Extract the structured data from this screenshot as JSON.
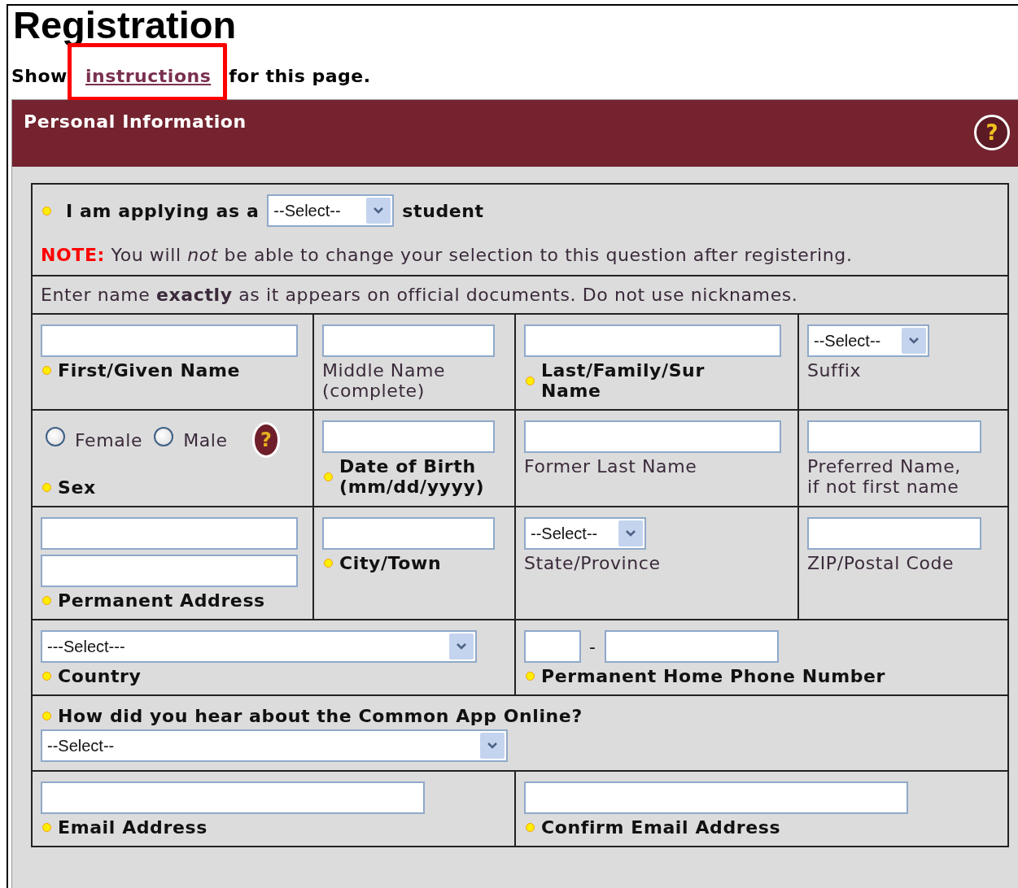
{
  "title": "Registration",
  "intro": {
    "before": "Show",
    "link": "instructions",
    "after": "for this page.",
    "highlighted": true
  },
  "panel": {
    "title": "Personal Information",
    "help": "?"
  },
  "applying": {
    "label": "I am applying as a",
    "required": true,
    "select": "--Select--",
    "after": "student",
    "note_label": "NOTE:",
    "note": "You will *not* be able to change your selection to this question after registering."
  },
  "name_hint": "Enter name **exactly** as it appears on official documents. Do not use nicknames.",
  "rows": [
    [
      {
        "kind": "field",
        "controls": [
          {
            "kind": "text"
          }
        ],
        "label": "First/Given Name",
        "required": true
      },
      {
        "kind": "field",
        "controls": [
          {
            "kind": "text"
          }
        ],
        "label": "Middle Name (complete)",
        "required": false
      },
      {
        "kind": "field",
        "controls": [
          {
            "kind": "text"
          }
        ],
        "label": "Last/Family/Sur Name",
        "required": true
      },
      {
        "kind": "field",
        "controls": [
          {
            "kind": "select",
            "value": "--Select--"
          }
        ],
        "label": "Suffix",
        "required": false
      }
    ],
    [
      {
        "kind": "field",
        "controls": [
          {
            "kind": "radio",
            "label": "Female",
            "checked": false
          },
          {
            "kind": "radio",
            "label": "Male",
            "checked": false
          },
          {
            "kind": "help",
            "text": "?"
          }
        ],
        "label": "Sex",
        "required": true
      },
      {
        "kind": "field",
        "controls": [
          {
            "kind": "text"
          }
        ],
        "label": "Date of Birth (mm/dd/yyyy)",
        "required": true
      },
      {
        "kind": "field",
        "controls": [
          {
            "kind": "text"
          }
        ],
        "label": "Former Last Name",
        "required": false
      },
      {
        "kind": "field",
        "controls": [
          {
            "kind": "text"
          }
        ],
        "label": "Preferred Name, if not first name",
        "required": false
      }
    ],
    [
      {
        "kind": "field",
        "controls": [
          {
            "kind": "text"
          },
          {
            "kind": "text"
          }
        ],
        "label": "Permanent Address",
        "required": true
      },
      {
        "kind": "field",
        "controls": [
          {
            "kind": "text"
          }
        ],
        "label": "City/Town",
        "required": true
      },
      {
        "kind": "field",
        "controls": [
          {
            "kind": "select",
            "value": "--Select--"
          }
        ],
        "label": "State/Province",
        "required": false
      },
      {
        "kind": "field",
        "controls": [
          {
            "kind": "text"
          }
        ],
        "label": "ZIP/Postal Code",
        "required": false
      }
    ],
    [
      {
        "kind": "field",
        "controls": [
          {
            "kind": "select",
            "value": "---Select---"
          }
        ],
        "label": "Country",
        "required": true
      },
      {
        "kind": "field",
        "controls": [
          {
            "kind": "area_code"
          },
          {
            "kind": "separator",
            "text": "-"
          },
          {
            "kind": "phone"
          }
        ],
        "label": "Permanent Home Phone Number",
        "required": true
      }
    ],
    [
      {
        "kind": "question",
        "controls": [
          {
            "kind": "select",
            "value": "--Select--"
          }
        ],
        "label": "How did you hear about the Common App Online?",
        "required": true
      }
    ],
    [
      {
        "kind": "field",
        "controls": [
          {
            "kind": "text"
          }
        ],
        "label": "Email Address",
        "required": true
      },
      {
        "kind": "field",
        "controls": [
          {
            "kind": "text"
          }
        ],
        "label": "Confirm Email Address",
        "required": true
      }
    ]
  ]
}
